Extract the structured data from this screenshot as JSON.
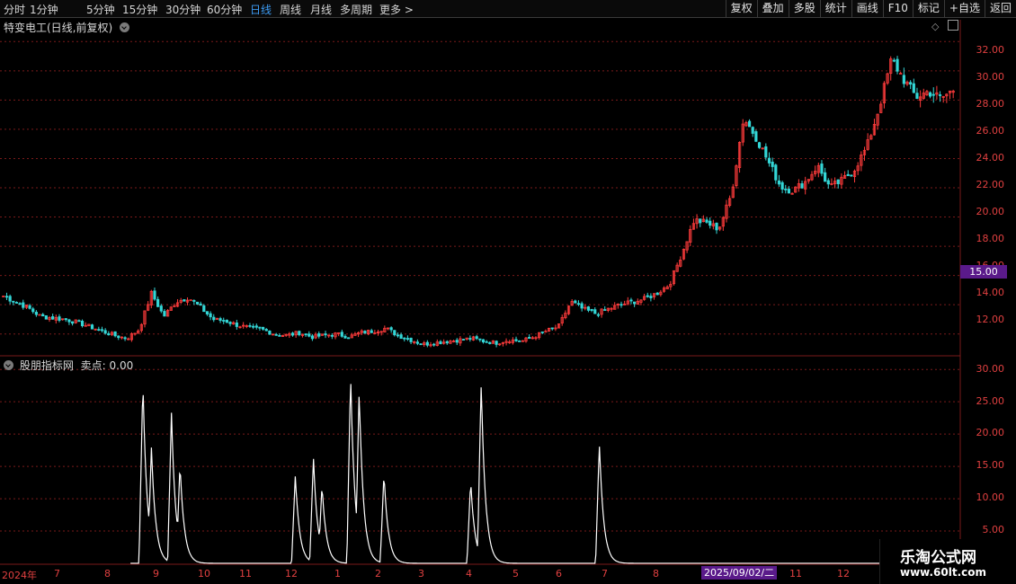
{
  "toolbar": {
    "timeframes": [
      "分时",
      "1分钟",
      "5分钟",
      "15分钟",
      "30分钟",
      "60分钟",
      "日线",
      "周线",
      "月线",
      "多周期",
      "更多 >"
    ],
    "active_timeframe": "日线",
    "buttons": [
      "复权",
      "叠加",
      "多股",
      "统计",
      "画线",
      "F10",
      "标记",
      "+自选",
      "返回"
    ]
  },
  "main_panel": {
    "title": "特变电工(日线,前复权)",
    "current_price_tag": "15.00"
  },
  "indicator_panel": {
    "title": "股朋指标网",
    "value_label": "卖点: 0.00"
  },
  "x_axis": {
    "labels": [
      "2024年",
      "7",
      "8",
      "9",
      "10",
      "11",
      "12",
      "1",
      "2",
      "3",
      "4",
      "5",
      "6",
      "7",
      "8",
      "11",
      "12"
    ],
    "cursor_date": "2025/09/02/二"
  },
  "watermark": {
    "line1": "乐淘公式网",
    "line2": "www.60lt.com"
  },
  "colors": {
    "up": "#ff3b3b",
    "down": "#33d6d6",
    "grid": "#7a1a1a",
    "axis_text": "#e04040",
    "highlight": "#5a1a8a",
    "active_tab": "#3d9cf5"
  },
  "chart_data": [
    {
      "type": "candlestick",
      "series": [
        {
          "name": "特变电工",
          "close": [
            14.6,
            14.2,
            13.8,
            13.2,
            13.1,
            13.0,
            12.8,
            12.5,
            12.2,
            11.9,
            11.7,
            12.3,
            14.8,
            13.2,
            14.2,
            14.5,
            13.8,
            13.0,
            12.9,
            12.6,
            12.4,
            12.3,
            12.0,
            11.9,
            12.1,
            11.8,
            11.9,
            12.0,
            11.8,
            12.1,
            12.2,
            12.4,
            11.9,
            11.6,
            11.3,
            11.4,
            11.5,
            11.6,
            11.7,
            11.5,
            11.4,
            11.6,
            11.5,
            11.8,
            12.2,
            12.5,
            14.2,
            13.7,
            13.4,
            13.7,
            14.0,
            14.2,
            14.4,
            14.8,
            15.4,
            17.5,
            19.8,
            19.6,
            19.2,
            21.5,
            26.8,
            25.5,
            23.8,
            22.1,
            21.8,
            22.4,
            23.5,
            22.0,
            22.5,
            23.3,
            24.8,
            27.5,
            30.8,
            29.4,
            28.2,
            28.6,
            28.1,
            28.7
          ]
        }
      ],
      "ylim": [
        11,
        33
      ],
      "yticks": [
        12,
        14,
        16,
        18,
        20,
        22,
        24,
        26,
        28,
        30,
        32
      ],
      "ytick_labels": [
        "12.00",
        "14.00",
        "16.00",
        "18.00",
        "20.00",
        "22.00",
        "24.00",
        "26.00",
        "28.00",
        "30.00",
        "32.00"
      ]
    },
    {
      "type": "line",
      "series": [
        {
          "name": "卖点",
          "peaks": [
            {
              "pos": 0.148,
              "value": 28.3
            },
            {
              "pos": 0.157,
              "value": 18.0
            },
            {
              "pos": 0.178,
              "value": 23.3
            },
            {
              "pos": 0.187,
              "value": 15.4
            },
            {
              "pos": 0.308,
              "value": 13.6
            },
            {
              "pos": 0.327,
              "value": 16.4
            },
            {
              "pos": 0.336,
              "value": 12.2
            },
            {
              "pos": 0.366,
              "value": 29.3
            },
            {
              "pos": 0.375,
              "value": 26.8
            },
            {
              "pos": 0.401,
              "value": 14.0
            },
            {
              "pos": 0.492,
              "value": 12.8
            },
            {
              "pos": 0.503,
              "value": 28.0
            },
            {
              "pos": 0.627,
              "value": 18.5
            }
          ]
        }
      ],
      "ylim": [
        0,
        31
      ],
      "yticks": [
        5,
        10,
        15,
        20,
        25,
        30
      ],
      "ytick_labels": [
        "5.00",
        "10.00",
        "15.00",
        "20.00",
        "25.00",
        "30.00"
      ]
    }
  ]
}
